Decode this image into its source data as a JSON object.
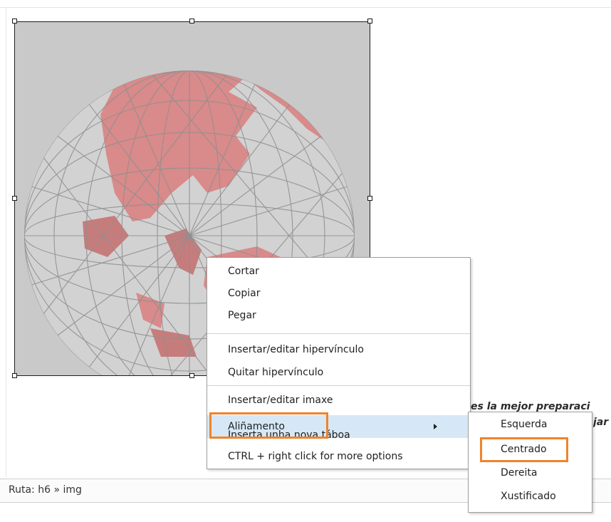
{
  "document": {
    "line1": "es la mejor preparaci",
    "line2": "jar"
  },
  "image": {
    "description_icon": "globe-image",
    "colors": {
      "background": "#c9c9c9",
      "land": "#d98a8a",
      "grid": "#8f8f8f"
    }
  },
  "status_bar": {
    "path": "Ruta: h6 » img"
  },
  "context_menu": {
    "items": [
      {
        "label": "Cortar"
      },
      {
        "label": "Copiar"
      },
      {
        "label": "Pegar"
      },
      {
        "label": "Insertar/editar hipervínculo"
      },
      {
        "label": "Quitar hipervínculo"
      },
      {
        "label": "Insertar/editar imaxe"
      },
      {
        "label": "Aliñamento",
        "has_submenu": true,
        "active": true
      },
      {
        "label": "Inserta unha nova táboa"
      },
      {
        "label": "CTRL + right click for more options"
      }
    ]
  },
  "submenu": {
    "items": [
      {
        "label": "Esquerda"
      },
      {
        "label": "Centrado",
        "highlighted": true
      },
      {
        "label": "Dereita"
      },
      {
        "label": "Xustificado"
      }
    ]
  },
  "accent_color": "#f0832a",
  "active_row_color": "#d6e8f6"
}
